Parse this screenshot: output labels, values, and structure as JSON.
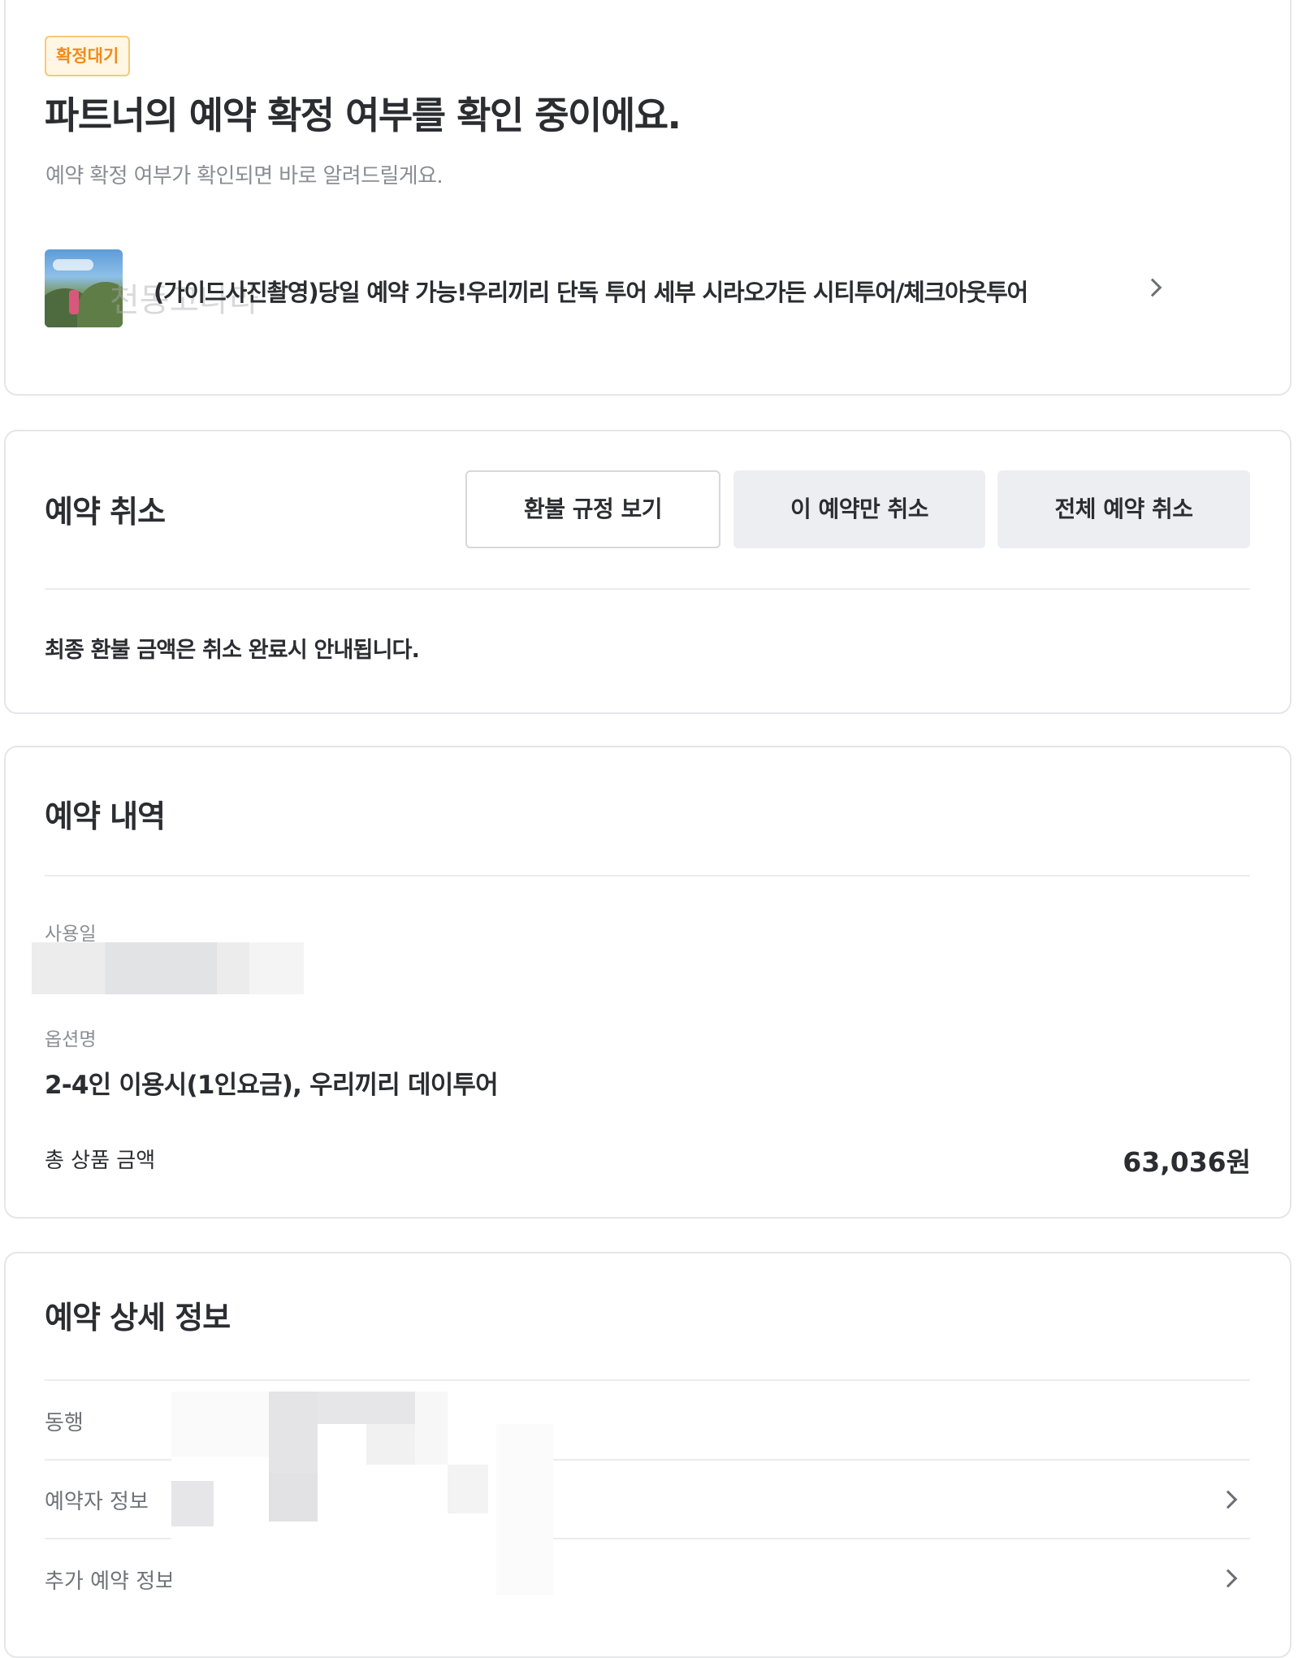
{
  "status": {
    "badge": "확정대기",
    "title": "파트너의 예약 확정 여부를 확인 중이에요.",
    "subtitle": "예약 확정 여부가 확인되면 바로 알려드릴게요."
  },
  "product": {
    "title": "(가이드사진촬영)당일 예약 가능!우리끼리 단독 투어 세부 시라오가든 시티투어/체크아웃투어",
    "thumbnail_icon": "product-photo"
  },
  "cancel": {
    "title": "예약 취소",
    "refund_policy_button": "환불 규정 보기",
    "cancel_this_button": "이 예약만 취소",
    "cancel_all_button": "전체 예약 취소",
    "refund_note": "최종 환불 금액은 취소 완료시 안내됩니다."
  },
  "booking": {
    "title": "예약 내역",
    "usage_date_label": "사용일",
    "option_label": "옵션명",
    "option_value": "2-4인 이용시(1인요금), 우리끼리 데이투어",
    "total_label": "총 상품 금액",
    "total_value": "63,036원"
  },
  "details": {
    "title": "예약 상세 정보",
    "rows": [
      {
        "label": "동행"
      },
      {
        "label": "예약자 정보"
      },
      {
        "label": "추가 예약 정보"
      }
    ]
  },
  "colors": {
    "badge_text": "#f08a1c",
    "badge_bg": "#fff7e3",
    "badge_border": "#f7c873",
    "button_gray": "#eceef1"
  }
}
